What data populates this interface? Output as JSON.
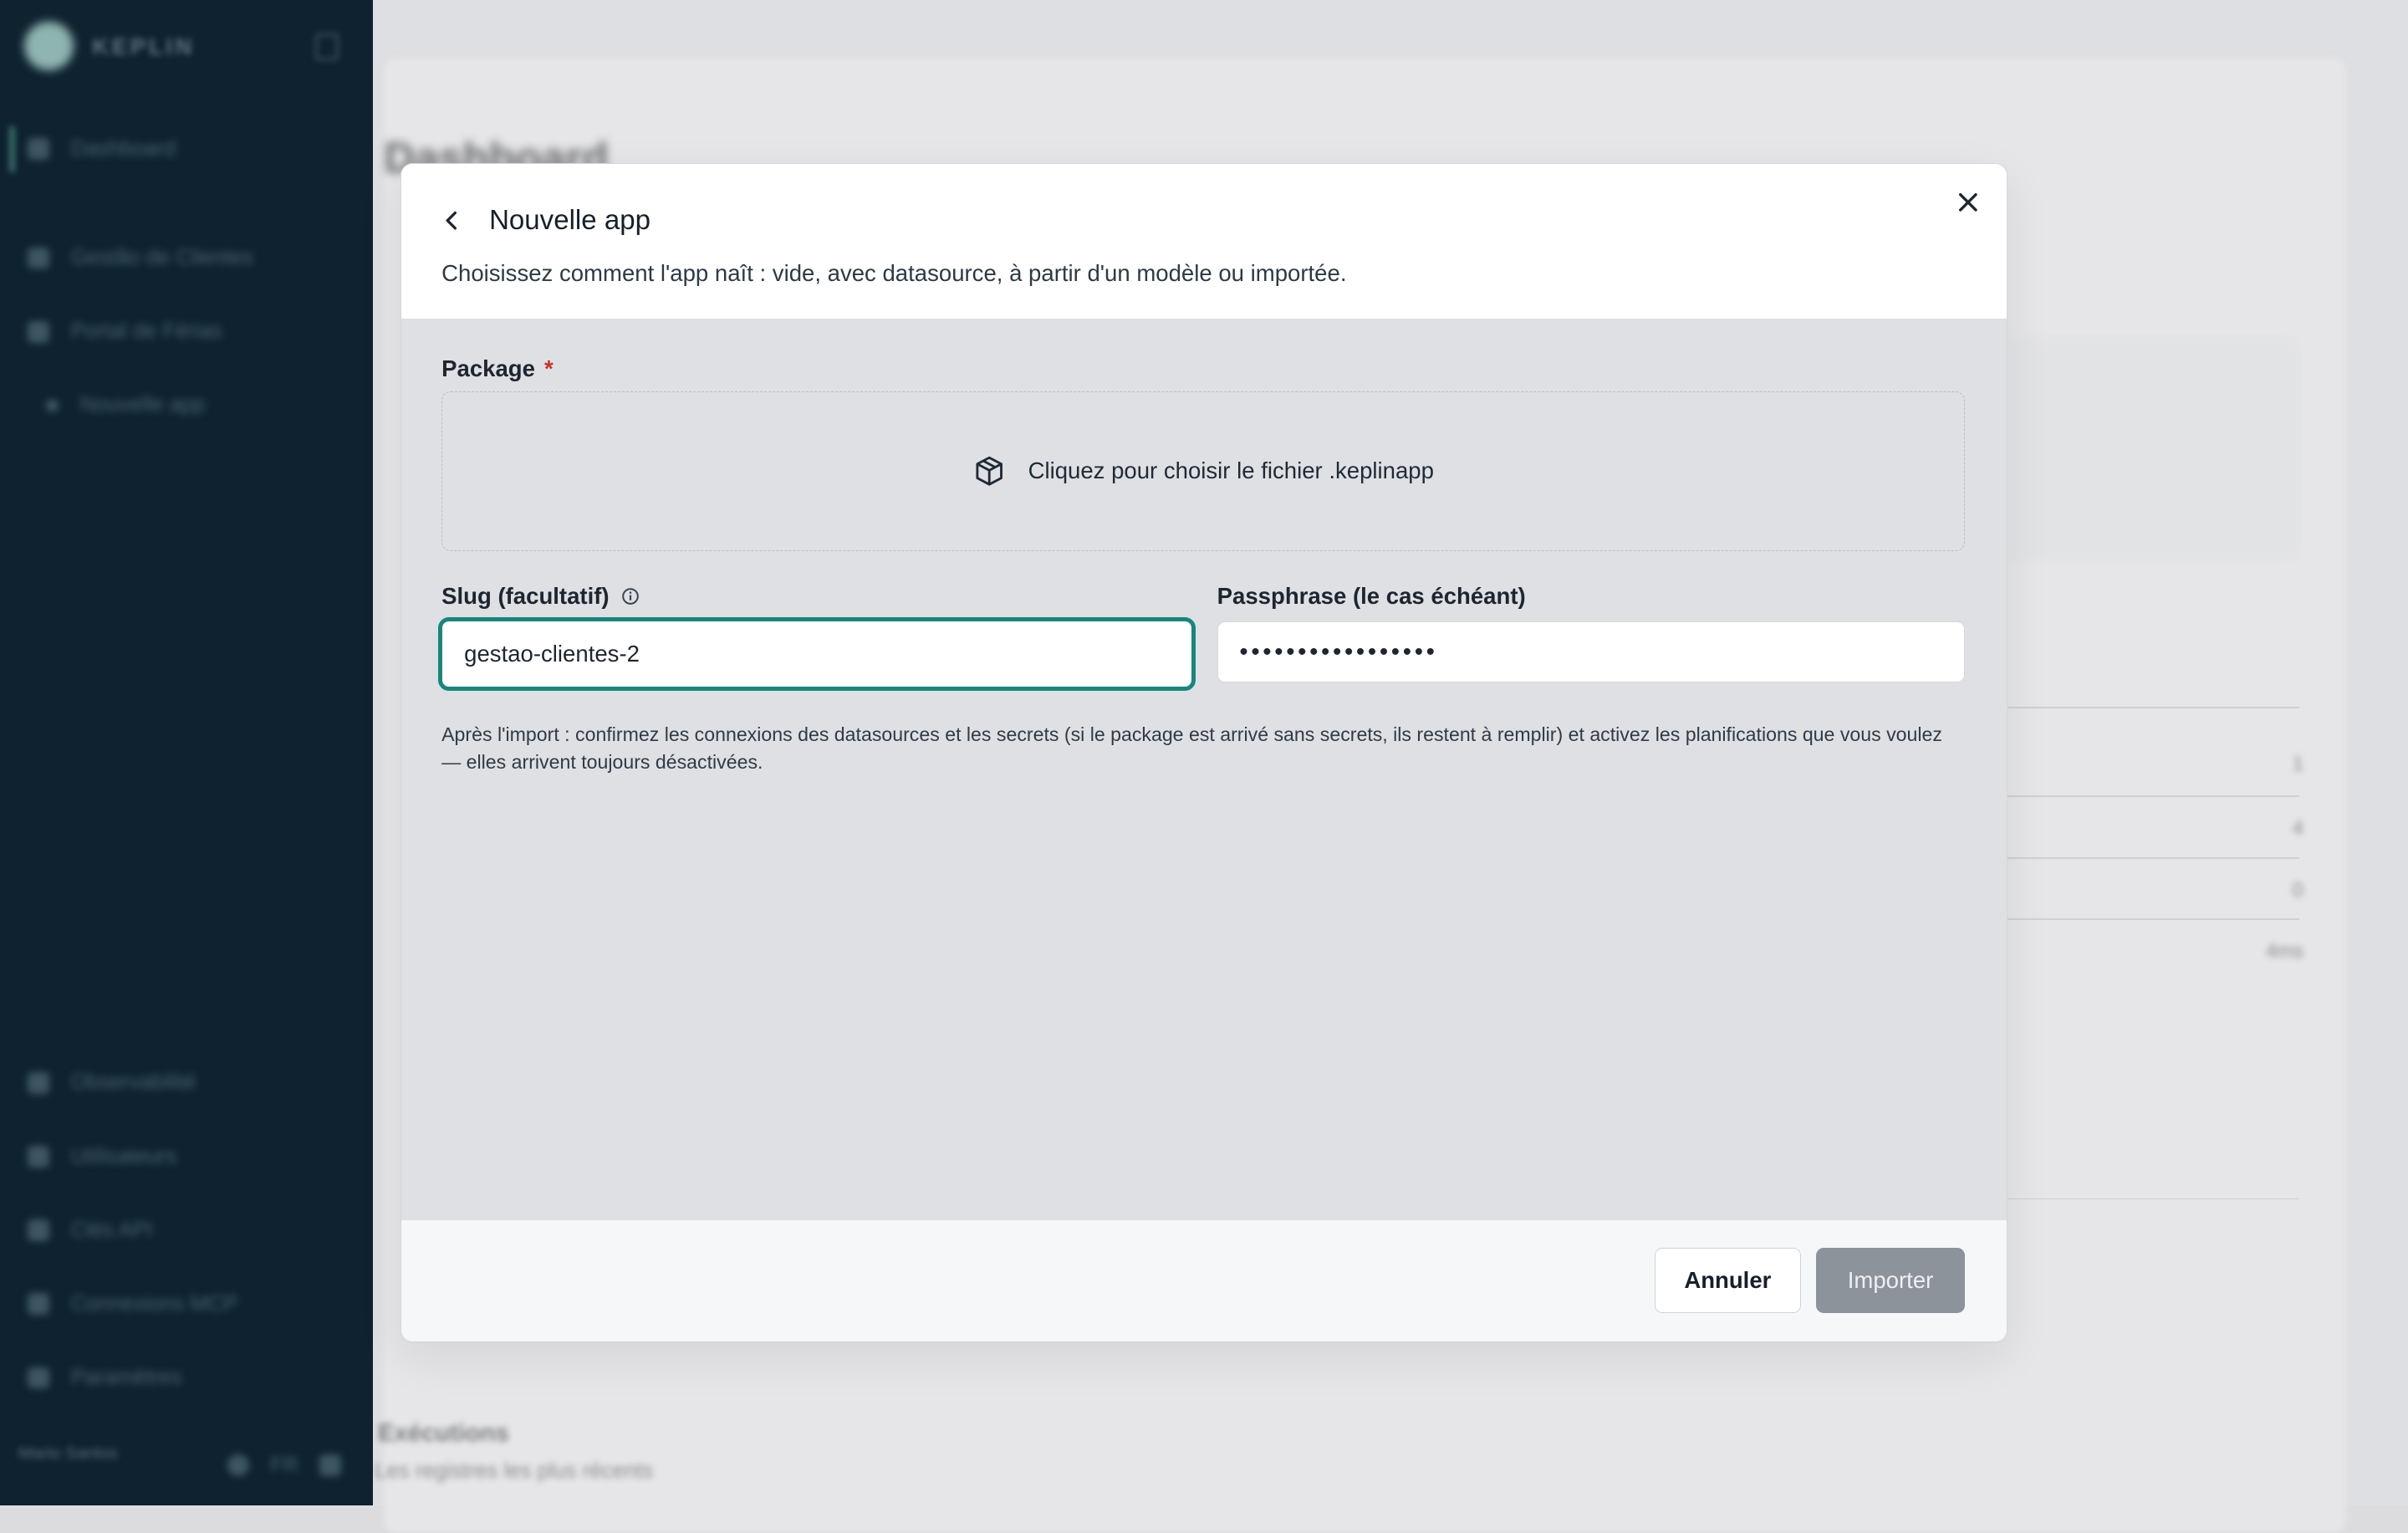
{
  "background": {
    "brand": "KEPLIN",
    "page_title": "Dashboard",
    "nav_items": [
      "Dashboard",
      "Gestão de Clientes",
      "Portal de Férias",
      "Nouvelle app",
      "Observabilité",
      "Utilisateurs",
      "Clés API",
      "Connexions MCP",
      "Paramètres"
    ],
    "user_name": "Mario Santos",
    "user_lang": "FR",
    "recent_title": "Exécutions",
    "recent_subtitle": "Les registres les plus récents",
    "stats": [
      "1",
      "4",
      "0",
      "4ms"
    ]
  },
  "modal": {
    "title": "Nouvelle app",
    "subtitle": "Choisissez comment l'app naît : vide, avec datasource, à partir d'un modèle ou importée.",
    "package_label": "Package",
    "required_marker": "*",
    "dropzone_text": "Cliquez pour choisir le fichier .keplinapp",
    "slug_label": "Slug (facultatif)",
    "slug_value": "gestao-clientes-2",
    "passphrase_label": "Passphrase (le cas échéant)",
    "passphrase_value": "•••••••••••••••••",
    "note": "Après l'import : confirmez les connexions des datasources et les secrets (si le package est arrivé sans secrets, ils restent à remplir) et activez les planifications que vous voulez — elles arrivent toujours désactivées.",
    "cancel_label": "Annuler",
    "import_label": "Importer"
  },
  "icons": {
    "back": "chevron-left-icon",
    "close": "close-icon",
    "package": "package-icon",
    "info": "info-icon"
  },
  "colors": {
    "sidebar": "#0e2230",
    "focus_ring": "#17867e",
    "required": "#c8312b",
    "import_disabled": "#8c939a"
  }
}
